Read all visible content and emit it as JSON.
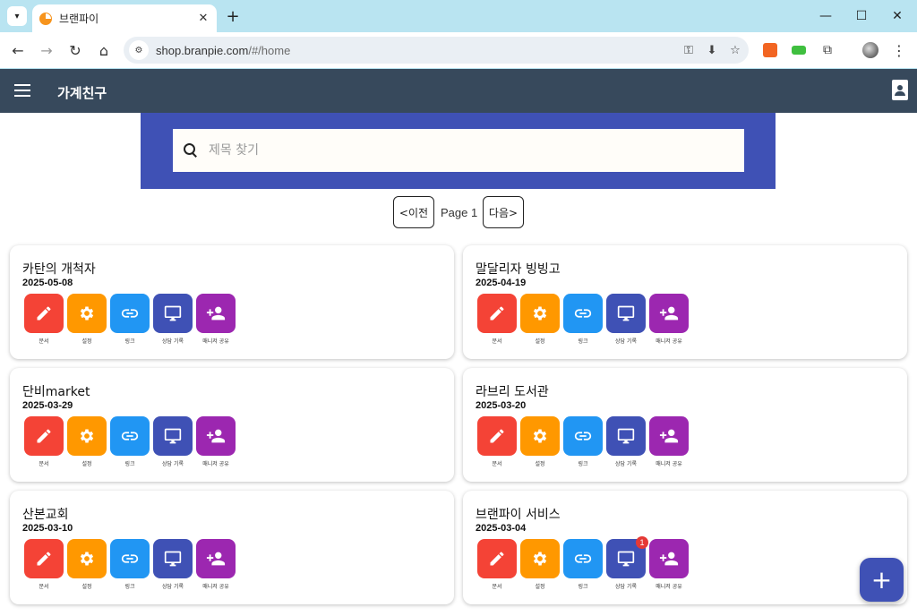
{
  "browser": {
    "tab_title": "브랜파이",
    "new_tab_label": "+",
    "url_host": "shop.branpie.com",
    "url_path": "/#/home"
  },
  "app": {
    "title": "가계친구"
  },
  "search": {
    "placeholder": "제목 찾기",
    "banner_color": "#3f51b5"
  },
  "pager": {
    "prev_label": "<이전",
    "page_label": "Page 1",
    "next_label": "다음>"
  },
  "action_labels": {
    "doc": "문서",
    "settings": "설정",
    "link": "링크",
    "consult": "상담 기록",
    "manager": "매니저 공유"
  },
  "action_colors": {
    "doc": "#f44336",
    "settings": "#ff9800",
    "link": "#2196f3",
    "consult": "#3f51b5",
    "manager": "#9c27b0"
  },
  "shops": [
    {
      "name": "카탄의 개척자",
      "date": "2025-05-08"
    },
    {
      "name": "말달리자 빙빙고",
      "date": "2025-04-19"
    },
    {
      "name": "단비market",
      "date": "2025-03-29"
    },
    {
      "name": "라브리 도서관",
      "date": "2025-03-20"
    },
    {
      "name": "산본교회",
      "date": "2025-03-10"
    },
    {
      "name": "브랜파이 서비스",
      "date": "2025-03-04",
      "consult_badge": "1"
    }
  ],
  "fab_label": "+"
}
